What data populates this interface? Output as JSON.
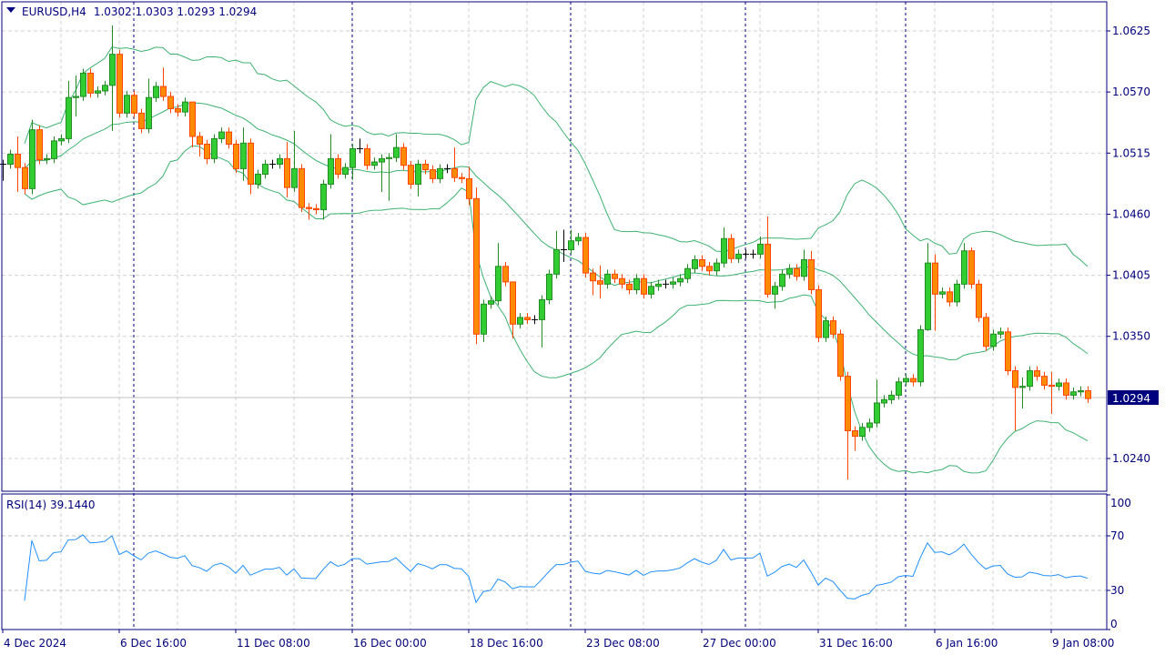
{
  "header": {
    "symbol": "EURUSD,H4",
    "ohlc_text": "1.0302 1.0303 1.0293 1.0294",
    "open": "1.0302",
    "high": "1.0303",
    "low": "1.0293",
    "close": "1.0294"
  },
  "current_price_label": "1.0294",
  "rsi_label": "RSI(14) 39.1440",
  "colors": {
    "bull": "#32cd32",
    "bull_border": "#228b22",
    "bear": "#ff8c00",
    "bear_border": "#ff4500",
    "doji": "#000000",
    "bands": "#3cb371",
    "rsi": "#1e90ff",
    "axis": "#00007f",
    "grid": "#d3d3d3",
    "separator": "#00007f",
    "price_label_bg": "#00007f"
  },
  "chart_data": [
    {
      "type": "candlestick",
      "title": "EURUSD,H4",
      "price_ticks": [
        "1.0625",
        "1.0570",
        "1.0515",
        "1.0460",
        "1.0405",
        "1.0350",
        "1.0240"
      ],
      "ylim": [
        1.0195,
        1.0652
      ],
      "x_labels": [
        {
          "index": 0,
          "label": "4 Dec 2024"
        },
        {
          "index": 16,
          "label": "6 Dec 16:00"
        },
        {
          "index": 32,
          "label": "11 Dec 08:00"
        },
        {
          "index": 48,
          "label": "16 Dec 00:00"
        },
        {
          "index": 64,
          "label": "18 Dec 16:00"
        },
        {
          "index": 80,
          "label": "23 Dec 08:00"
        },
        {
          "index": 96,
          "label": "27 Dec 00:00"
        },
        {
          "index": 112,
          "label": "31 Dec 16:00"
        },
        {
          "index": 128,
          "label": "6 Jan 16:00"
        },
        {
          "index": 144,
          "label": "9 Jan 08:00"
        }
      ],
      "period_separators": [
        18,
        48,
        78,
        102,
        124
      ],
      "first_open": 1.0505,
      "close": [
        1.0505,
        1.0514,
        1.0502,
        1.0483,
        1.0536,
        1.0509,
        1.051,
        1.0526,
        1.0528,
        1.0565,
        1.0566,
        1.0587,
        1.0569,
        1.0571,
        1.0576,
        1.0604,
        1.0551,
        1.0567,
        1.0551,
        1.0537,
        1.0565,
        1.0575,
        1.0566,
        1.0555,
        1.0552,
        1.0561,
        1.053,
        1.0523,
        1.051,
        1.0528,
        1.0534,
        1.0523,
        1.0501,
        1.0524,
        1.0487,
        1.0496,
        1.0505,
        1.0505,
        1.051,
        1.0484,
        1.0501,
        1.0466,
        1.0465,
        1.0464,
        1.0487,
        1.051,
        1.0496,
        1.0502,
        1.0519,
        1.0519,
        1.0504,
        1.0507,
        1.051,
        1.0511,
        1.052,
        1.0504,
        1.0487,
        1.0505,
        1.05,
        1.0492,
        1.0501,
        1.0501,
        1.0493,
        1.0492,
        1.0474,
        1.0352,
        1.0379,
        1.0382,
        1.0413,
        1.0399,
        1.0361,
        1.0367,
        1.0365,
        1.0365,
        1.0383,
        1.0406,
        1.0428,
        1.0428,
        1.0436,
        1.0439,
        1.0407,
        1.04,
        1.0397,
        1.0406,
        1.0402,
        1.0397,
        1.0392,
        1.0402,
        1.0388,
        1.0395,
        1.0397,
        1.0397,
        1.0399,
        1.0402,
        1.0411,
        1.0419,
        1.0413,
        1.0409,
        1.0416,
        1.0438,
        1.042,
        1.0424,
        1.0424,
        1.0424,
        1.0433,
        1.0388,
        1.0395,
        1.0406,
        1.0411,
        1.0404,
        1.0419,
        1.0392,
        1.0349,
        1.0364,
        1.0352,
        1.0314,
        1.0265,
        1.026,
        1.0268,
        1.0272,
        1.029,
        1.0293,
        1.0297,
        1.0309,
        1.0312,
        1.0309,
        1.0356,
        1.0416,
        1.0388,
        1.039,
        1.0381,
        1.0397,
        1.0427,
        1.0397,
        1.0367,
        1.0341,
        1.0352,
        1.0354,
        1.0319,
        1.0304,
        1.0305,
        1.0319,
        1.0314,
        1.0306,
        1.0305,
        1.0308,
        1.0297,
        1.03,
        1.0301,
        1.0294
      ],
      "default_wick": 0.0004,
      "wick_extremes": {
        "0": {
          "l": 1.049
        },
        "2": {
          "h": 1.053,
          "l": 1.048
        },
        "3": {
          "l": 1.0478
        },
        "4": {
          "h": 1.0545,
          "l": 1.0478
        },
        "9": {
          "h": 1.058
        },
        "10": {
          "h": 1.0585,
          "l": 1.0548
        },
        "15": {
          "h": 1.063,
          "l": 1.0535
        },
        "16": {
          "h": 1.0608
        },
        "20": {
          "h": 1.0582
        },
        "22": {
          "h": 1.0592
        },
        "26": {
          "h": 1.056,
          "l": 1.052
        },
        "27": {
          "l": 1.0512
        },
        "28": {
          "l": 1.0505
        },
        "33": {
          "h": 1.0538,
          "l": 1.049
        },
        "34": {
          "l": 1.0478
        },
        "39": {
          "h": 1.0525,
          "l": 1.0475
        },
        "40": {
          "h": 1.0535,
          "l": 1.048
        },
        "42": {
          "l": 1.0455
        },
        "44": {
          "l": 1.0455
        },
        "45": {
          "h": 1.0532
        },
        "48": {
          "l": 1.0491
        },
        "49": {
          "h": 1.0528
        },
        "52": {
          "l": 1.048
        },
        "53": {
          "l": 1.0472
        },
        "54": {
          "h": 1.0532
        },
        "57": {
          "l": 1.0476
        },
        "62": {
          "h": 1.052
        },
        "64": {
          "h": 1.0503,
          "l": 1.0468
        },
        "65": {
          "h": 1.0484,
          "l": 1.0343
        },
        "66": {
          "l": 1.0345
        },
        "68": {
          "h": 1.0434
        },
        "70": {
          "h": 1.039,
          "l": 1.0348
        },
        "74": {
          "l": 1.034
        },
        "76": {
          "h": 1.0445
        },
        "77": {
          "h": 1.0446,
          "l": 1.0417
        },
        "78": {
          "h": 1.0446
        },
        "81": {
          "l": 1.0387
        },
        "82": {
          "h": 1.0414,
          "l": 1.0384
        },
        "99": {
          "h": 1.0448
        },
        "104": {
          "h": 1.044
        },
        "105": {
          "h": 1.0458,
          "l": 1.0385
        },
        "106": {
          "l": 1.0375
        },
        "110": {
          "h": 1.0428
        },
        "111": {
          "h": 1.0427
        },
        "112": {
          "l": 1.0345
        },
        "116": {
          "l": 1.0221
        },
        "117": {
          "l": 1.0247
        },
        "120": {
          "h": 1.0311
        },
        "127": {
          "h": 1.0434,
          "l": 1.0355
        },
        "128": {
          "h": 1.0424,
          "l": 1.0355
        },
        "132": {
          "h": 1.0434
        },
        "133": {
          "h": 1.043
        },
        "139": {
          "l": 1.0265
        },
        "140": {
          "h": 1.0313,
          "l": 1.0285
        },
        "144": {
          "h": 1.0318,
          "l": 1.028
        }
      },
      "indicators": [
        {
          "name": "Bollinger Bands",
          "period": 20,
          "deviations": 2
        },
        {
          "name": "RSI",
          "period": 14,
          "last_value": 39.144,
          "levels": [
            70,
            30
          ],
          "ylim": [
            0,
            100
          ],
          "ticks": [
            "100",
            "70",
            "30",
            "0"
          ]
        }
      ]
    }
  ]
}
